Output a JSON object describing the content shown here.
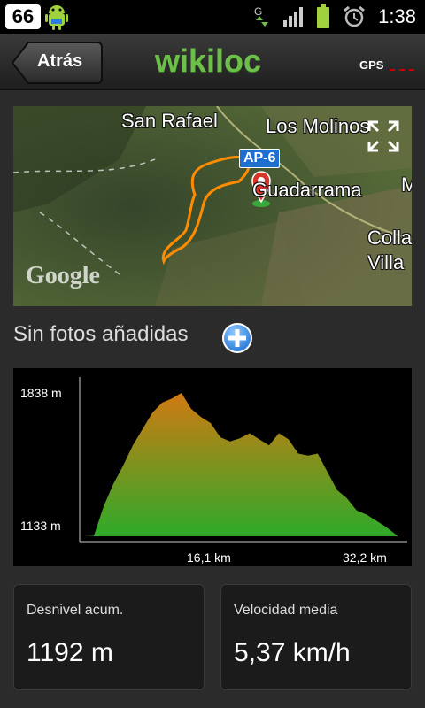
{
  "status_bar": {
    "badge": "66",
    "time": "1:38",
    "network_letter": "G",
    "icons": [
      "android-icon",
      "signal-icon",
      "battery-icon",
      "alarm-icon"
    ]
  },
  "header": {
    "back_label": "Atrás",
    "logo": "wikiloc",
    "gps_label": "GPS"
  },
  "map": {
    "places": [
      "San Rafael",
      "Los Molinos",
      "Guadarrama",
      "Colla",
      "Villa",
      "M"
    ],
    "road": "AP-6",
    "google": "Google",
    "route_color": "#ff8c00"
  },
  "photos": {
    "label": "Sin fotos añadidas"
  },
  "chart_data": {
    "type": "area",
    "title": "",
    "xlabel": "",
    "ylabel": "",
    "x_ticks": [
      "16,1 km",
      "32,2 km"
    ],
    "y_ticks": [
      "1838 m",
      "1133 m"
    ],
    "ylim": [
      1133,
      1838
    ],
    "xlim": [
      0,
      32.2
    ],
    "x": [
      0,
      1,
      2,
      3,
      4,
      5,
      6,
      7,
      8,
      9,
      10,
      11,
      12,
      13,
      14,
      15,
      16,
      17,
      18,
      19,
      20,
      21,
      22,
      23,
      24,
      25,
      26,
      27,
      28,
      29,
      30,
      31,
      32.2
    ],
    "values": [
      1133,
      1135,
      1280,
      1390,
      1480,
      1580,
      1660,
      1740,
      1790,
      1810,
      1838,
      1760,
      1720,
      1690,
      1620,
      1600,
      1615,
      1640,
      1610,
      1580,
      1640,
      1610,
      1540,
      1530,
      1540,
      1450,
      1360,
      1320,
      1260,
      1240,
      1210,
      1180,
      1135
    ],
    "gradient": [
      "#d07a12",
      "#2eaa2a"
    ]
  },
  "stats": [
    {
      "label": "Desnivel acum.",
      "value": "1192 m"
    },
    {
      "label": "Velocidad media",
      "value": "5,37 km/h"
    }
  ]
}
